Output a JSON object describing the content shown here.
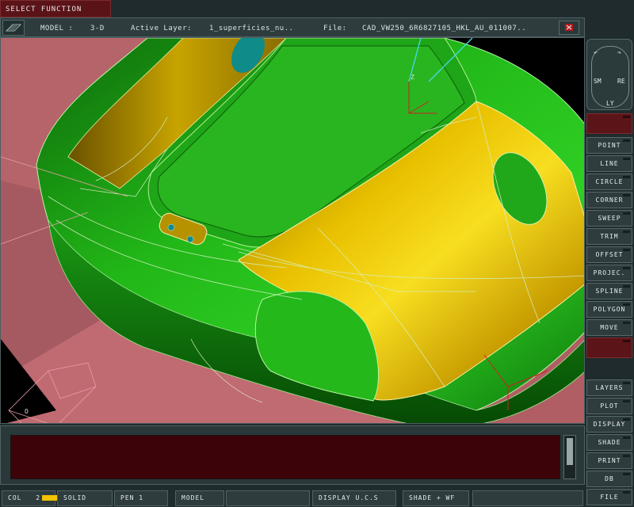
{
  "app": {
    "select_function": "SELECT FUNCTION"
  },
  "topbar": {
    "model_label": "MODEL :",
    "model_value": "3-D",
    "layer_label": "Active Layer:",
    "layer_value": "1_superficies_nu..",
    "file_label": "File:",
    "file_value": "CAD_VW250_6R6827105_HKL_AU_011007.."
  },
  "nav_pad": {
    "sm": "SM",
    "re": "RE",
    "ly": "LY"
  },
  "sidebar": {
    "group1": [
      "POINT",
      "LINE",
      "CIRCLE",
      "CORNER",
      "SWEEP",
      "TRIM",
      "OFFSET",
      "PROJEC.",
      "SPLINE",
      "POLYGON",
      "MOVE"
    ],
    "group2": [
      "LAYERS",
      "PLOT",
      "DISPLAY",
      "SHADE",
      "PRINT",
      "DB",
      "FILE"
    ]
  },
  "status": {
    "col_label": "COL",
    "col_value": "2",
    "mode": "SOLID",
    "pen": "PEN 1",
    "space": "MODEL",
    "display": "DISPLAY U.C.S",
    "shade": "SHADE + WF"
  },
  "colors": {
    "accent_red": "#5a1418",
    "surface_green": "#21c21a",
    "surface_yellow": "#e0b200",
    "background_plane": "#b8656a",
    "col_swatch": "#f2c300"
  }
}
